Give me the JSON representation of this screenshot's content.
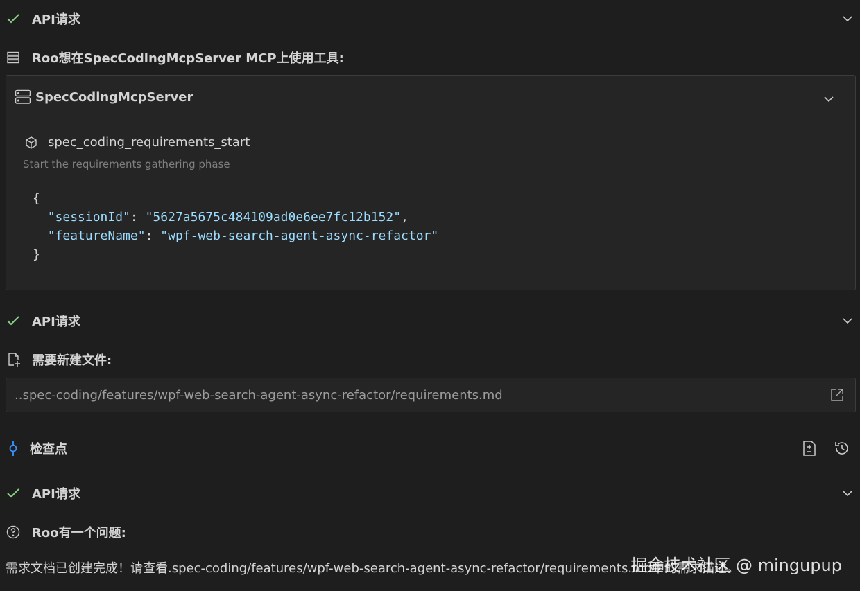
{
  "api_request_label": "API请求",
  "mcp_request": {
    "title": "Roo想在SpecCodingMcpServer MCP上使用工具:",
    "server_name": "SpecCodingMcpServer",
    "tool_name": "spec_coding_requirements_start",
    "tool_description": "Start the requirements gathering phase",
    "args": {
      "open_brace": "{",
      "close_brace": "}",
      "session_key": "\"sessionId\"",
      "session_value": "\"5627a5675c484109ad0e6ee7fc12b152\"",
      "feature_key": "\"featureName\"",
      "feature_value": "\"wpf-web-search-agent-async-refactor\""
    }
  },
  "new_file": {
    "title": "需要新建文件:",
    "path": "..spec-coding/features/wpf-web-search-agent-async-refactor/requirements.md"
  },
  "checkpoint": {
    "label": "检查点"
  },
  "question": {
    "title": "Roo有一个问题:",
    "message": "需求文档已创建完成！请查看.spec-coding/features/wpf-web-search-agent-async-refactor/requirements.md中的需求描述。"
  },
  "watermark": "掘金技术社区 @ mingupup",
  "colors": {
    "check": "#89d185",
    "accent": "#3794ff",
    "background": "#1e1e1e"
  }
}
